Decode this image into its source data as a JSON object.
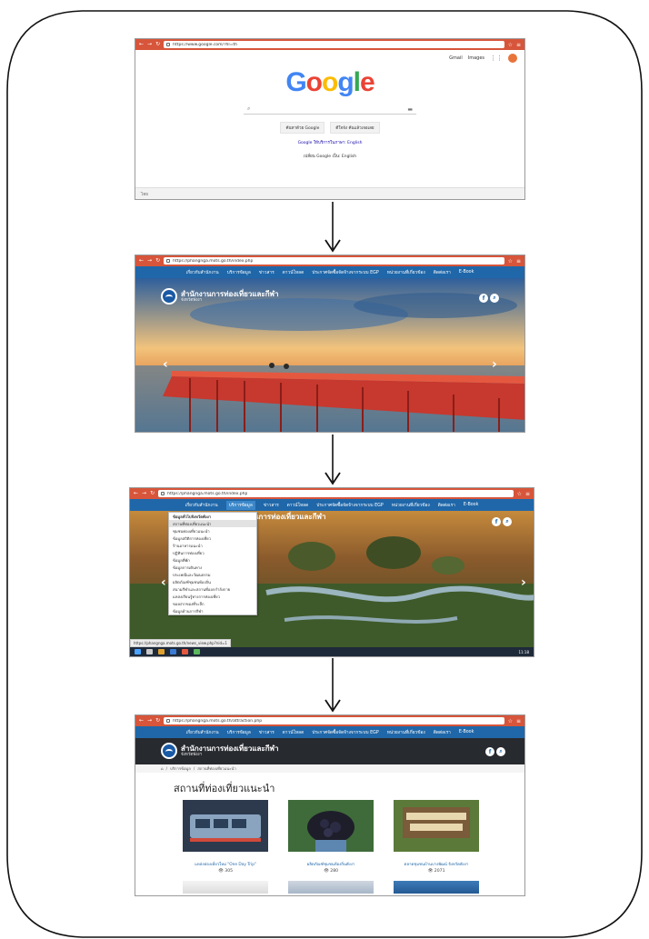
{
  "step1": {
    "tab_url": "https://www.google.com/?hl=th",
    "top_links": [
      "Gmail",
      "Images"
    ],
    "logo": "Google",
    "buttons": [
      "ค้นหาด้วย Google",
      "ดีใจจัง ค้นแล้วเจอเลย"
    ],
    "promo": "Google ให้บริการในภาษา: English",
    "lang_line": "เปลี่ยน Google เป็น: English",
    "footer": "ไทย"
  },
  "menu": {
    "items": [
      "เกี่ยวกับสำนักงาน",
      "บริการข้อมูล",
      "ข่าวสาร",
      "ดาวน์โหลด",
      "ประกาศจัดซื้อจัดจ้างจากระบบ EGP",
      "หน่วยงานที่เกี่ยวข้อง",
      "ติดต่อเรา",
      "E-Book"
    ]
  },
  "site": {
    "title": "สำนักงานการท่องเที่ยวและกีฬา",
    "subtitle": "จังหวัดพังงา",
    "url": "https://phangnga.mots.go.th/index.php"
  },
  "step3": {
    "url": "https://phangnga.mots.go.th/index.php",
    "status_url": "https://phangnga.mots.go.th/news_view.php?nid=1",
    "clock": "11:18",
    "dropdown": [
      "ข้อมูลทั่วไปจังหวัดพังงา",
      "สถานที่ท่องเที่ยวแนะนำ",
      "ชุมชนท่องเที่ยวแนะนำ",
      "ข้อมูลสถิติการท่องเที่ยว",
      "ร้านอาหารแนะนำ",
      "ปฏิทินการท่องเที่ยว",
      "ข้อมูลที่พัก",
      "ข้อมูลการเดินทาง",
      "ประเพณีและวัฒนธรรม",
      "ผลิตภัณฑ์ชุมชนท้องถิ่น",
      "สนามกีฬาและสถานที่ออกกำลังกาย",
      "แหล่งเรียนรู้ทางการท่องเที่ยว",
      "ของฝากของที่ระลึก",
      "ข้อมูลด้านการกีฬา"
    ]
  },
  "step4": {
    "url": "https://phangnga.mots.go.th/attraction.php",
    "breadcrumb": [
      "บริการข้อมูล",
      "สถานที่ท่องเที่ยวแนะนำ"
    ],
    "heading": "สถานที่ท่องเที่ยวแนะนำ",
    "cards": [
      {
        "caption": "แหล่งท่องเที่ยวใหม่ \"One Day Trip\"",
        "views": "305"
      },
      {
        "caption": "ผลิตภัณฑ์ชุมชนท้องถิ่นพังงา",
        "views": "280"
      },
      {
        "caption": "ตลาดชุมชนบ้านบางพัฒน์ จังหวัดพังงา",
        "views": "2071"
      }
    ]
  }
}
